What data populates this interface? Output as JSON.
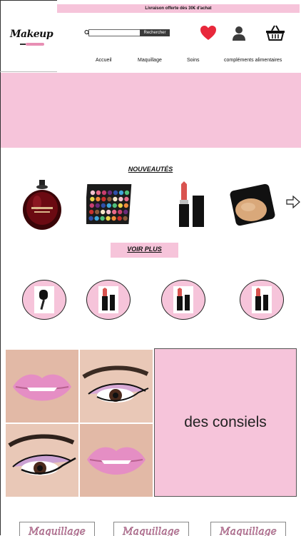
{
  "topbar": {
    "text": "Livraison offerte dès 30€ d'achat"
  },
  "logo": {
    "text": "Makeup"
  },
  "search": {
    "placeholder": "",
    "button_label": "Rechercher"
  },
  "nav": {
    "items": [
      "Accueil",
      "Maquillage",
      "Soins",
      "compléments alimentaires"
    ]
  },
  "new_arrivals": {
    "title": "NOUVEAUTÉS",
    "products": [
      "perfume",
      "eyeshadow-palette",
      "lipstick",
      "compact-powder"
    ],
    "see_more": "VOIR PLUS"
  },
  "circles": [
    "brush",
    "lipstick",
    "lipstick",
    "lipstick"
  ],
  "advice": {
    "label": "des consiels"
  },
  "bottom_logo": {
    "text": "Maquillage"
  },
  "colors": {
    "accent": "#f6c4da",
    "heart": "#e8283b",
    "button": "#3a3a3a"
  }
}
